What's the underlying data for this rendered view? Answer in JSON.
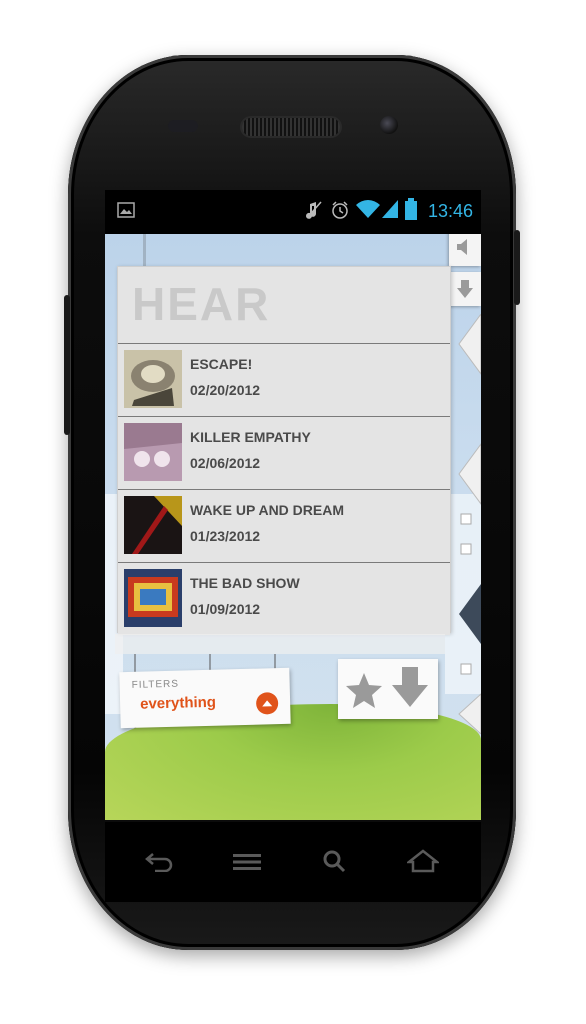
{
  "status_bar": {
    "time": "13:46"
  },
  "app": {
    "title": "HEAR",
    "episodes": [
      {
        "title": "ESCAPE!",
        "date": "02/20/2012"
      },
      {
        "title": "KILLER EMPATHY",
        "date": "02/06/2012"
      },
      {
        "title": "WAKE UP AND DREAM",
        "date": "01/23/2012"
      },
      {
        "title": "THE BAD SHOW",
        "date": "01/09/2012"
      }
    ],
    "filters": {
      "label": "FILTERS",
      "value": "everything"
    }
  },
  "colors": {
    "accent": "#e0531a",
    "status_blue": "#33b5e5"
  },
  "icons": {
    "status": [
      "gallery-icon",
      "mute-icon",
      "alarm-icon",
      "wifi-icon",
      "signal-icon",
      "battery-icon"
    ],
    "side_tabs": [
      "volume-icon",
      "download-arrow-icon"
    ],
    "nav": [
      "back-icon",
      "menu-icon",
      "search-icon",
      "home-icon"
    ],
    "actions": [
      "star-icon",
      "download-icon"
    ]
  }
}
